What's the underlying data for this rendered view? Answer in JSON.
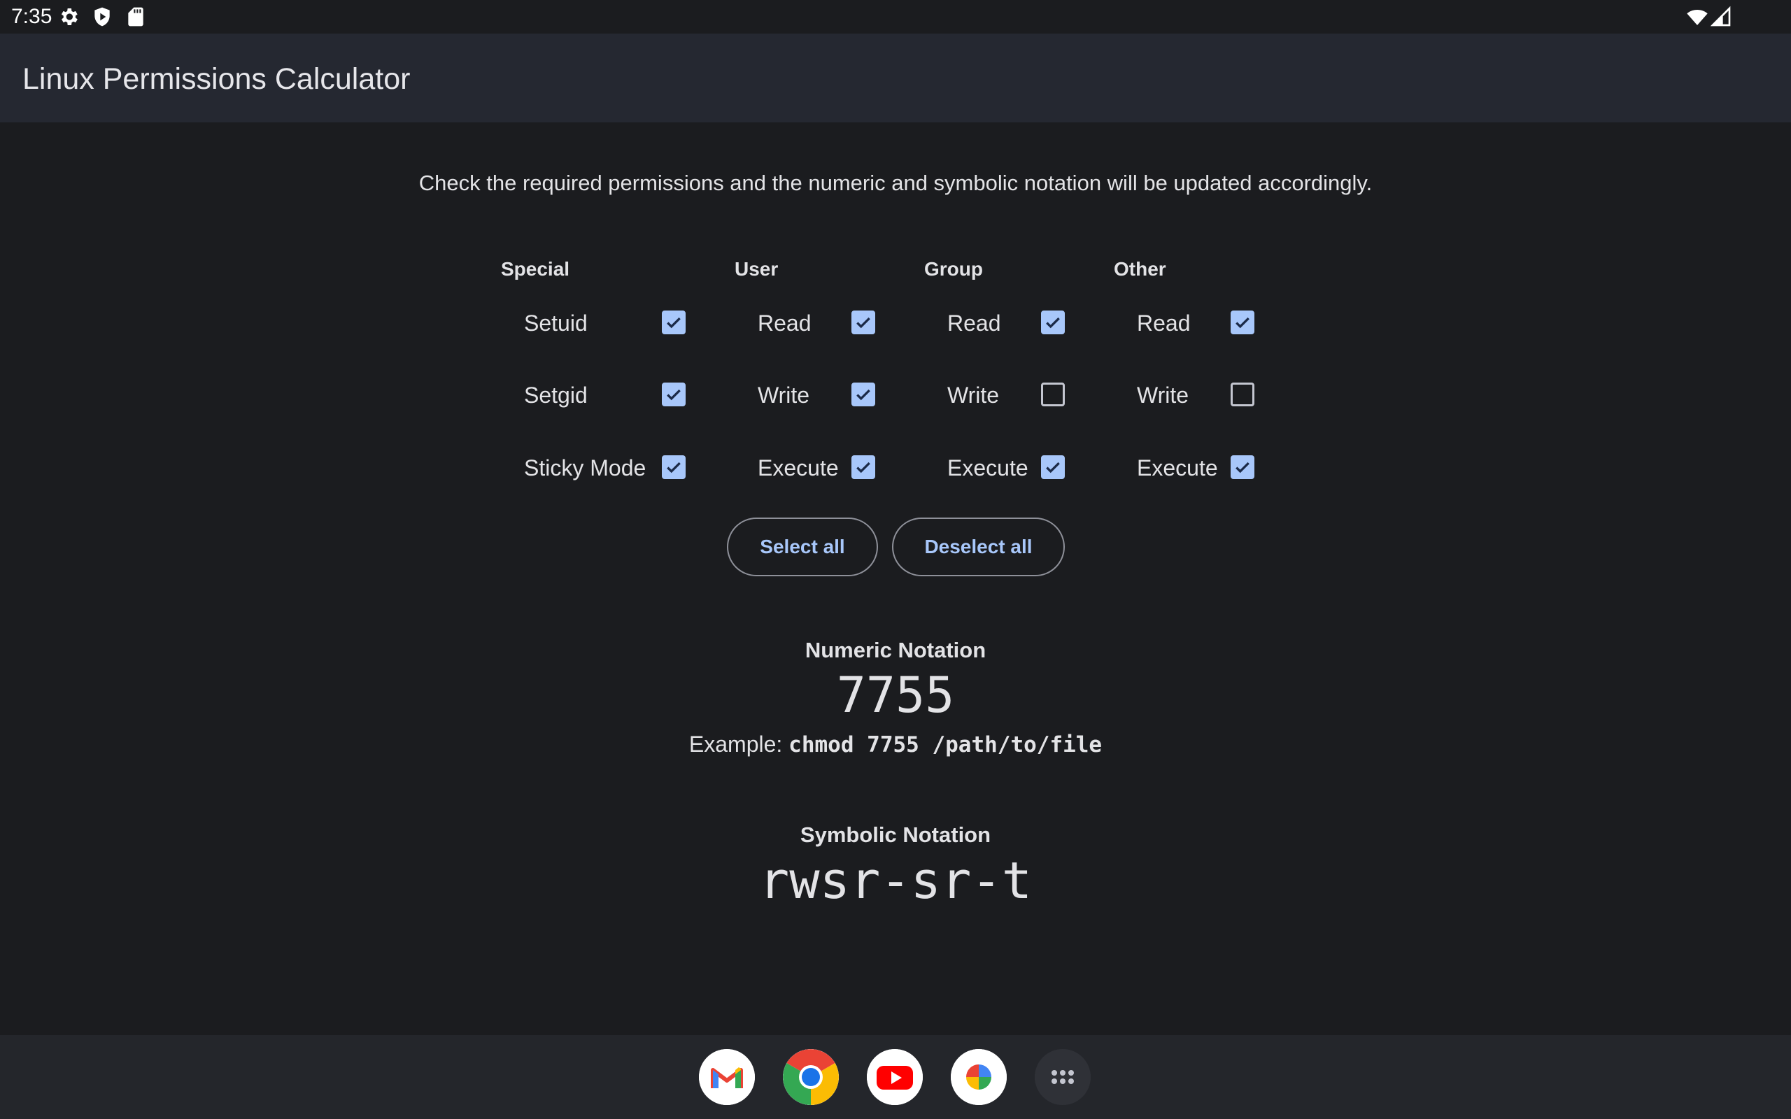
{
  "status_bar": {
    "time": "7:35",
    "left_icons": [
      "gear-icon",
      "shield-play-icon",
      "sd-card-icon"
    ],
    "right_icons": [
      "wifi-icon",
      "cell-signal-icon"
    ]
  },
  "app_bar": {
    "title": "Linux Permissions Calculator"
  },
  "instruction": "Check the required permissions and the numeric and symbolic notation will be updated accordingly.",
  "columns": [
    {
      "header": "Special",
      "items": [
        {
          "label": "Setuid",
          "checked": true
        },
        {
          "label": "Setgid",
          "checked": true
        },
        {
          "label": "Sticky Mode",
          "checked": true
        }
      ]
    },
    {
      "header": "User",
      "items": [
        {
          "label": "Read",
          "checked": true
        },
        {
          "label": "Write",
          "checked": true
        },
        {
          "label": "Execute",
          "checked": true
        }
      ]
    },
    {
      "header": "Group",
      "items": [
        {
          "label": "Read",
          "checked": true
        },
        {
          "label": "Write",
          "checked": false
        },
        {
          "label": "Execute",
          "checked": true
        }
      ]
    },
    {
      "header": "Other",
      "items": [
        {
          "label": "Read",
          "checked": true
        },
        {
          "label": "Write",
          "checked": false
        },
        {
          "label": "Execute",
          "checked": true
        }
      ]
    }
  ],
  "buttons": {
    "select_all": "Select all",
    "deselect_all": "Deselect all"
  },
  "numeric": {
    "title": "Numeric Notation",
    "value": "7755",
    "example_prefix": "Example: ",
    "example_command": "chmod 7755 /path/to/file"
  },
  "symbolic": {
    "title": "Symbolic Notation",
    "value": "rwsr-sr-t"
  },
  "taskbar": {
    "apps": [
      "gmail-icon",
      "chrome-icon",
      "youtube-icon",
      "photos-icon",
      "app-drawer-icon"
    ]
  },
  "colors": {
    "accent": "#a8c7fa",
    "background": "#1b1c1f",
    "app_bar": "#252831"
  }
}
